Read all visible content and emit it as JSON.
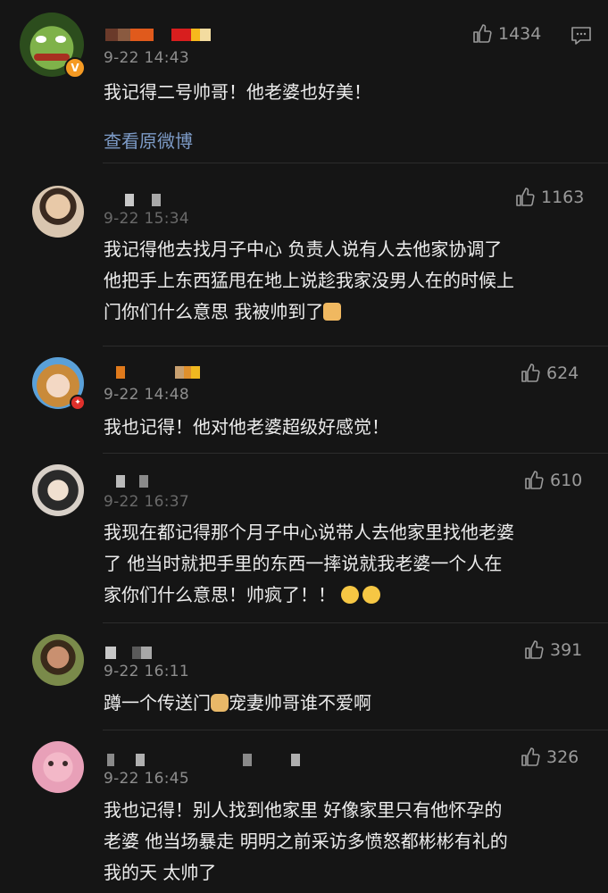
{
  "comments": [
    {
      "time": "9-22 14:43",
      "text": "我记得二号帅哥！他老婆也好美！",
      "likes": "1434",
      "link": "查看原微博"
    },
    {
      "time": "9-22 15:34",
      "text": "我记得他去找月子中心 负责人说有人去他家协调了\n他把手上东西猛甩在地上说趁我家没男人在的时候上\n门你们什么意思 我被帅到了",
      "likes": "1163"
    },
    {
      "time": "9-22 14:48",
      "text": "我也记得！他对他老婆超级好感觉！",
      "likes": "624"
    },
    {
      "time": "9-22 16:37",
      "text": "我现在都记得那个月子中心说带人去他家里找他老婆\n了 他当时就把手里的东西一摔说就我老婆一个人在\n家你们什么意思！帅疯了！！",
      "likes": "610"
    },
    {
      "time": "9-22 16:11",
      "text_a": "蹲一个传送门",
      "text_b": "宠妻帅哥谁不爱啊",
      "likes": "391"
    },
    {
      "time": "9-22 16:45",
      "text": "我也记得！别人找到他家里 好像家里只有他怀孕的\n老婆 他当场暴走 明明之前采访多愤怒都彬彬有礼的\n我的天 太帅了",
      "likes": "326"
    }
  ],
  "badges": {
    "verified": "V",
    "red": "✦"
  },
  "icons": {
    "like": "thumb-up-icon",
    "comment": "comment-icon"
  }
}
